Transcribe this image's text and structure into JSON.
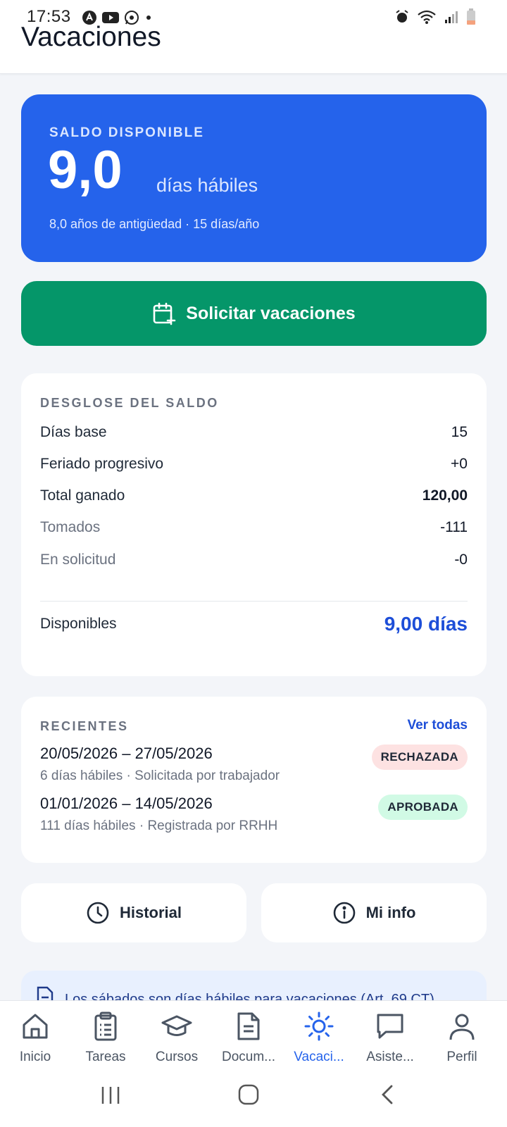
{
  "status_bar": {
    "time": "17:53"
  },
  "header": {
    "title": "Vacaciones"
  },
  "saldo": {
    "label": "SALDO DISPONIBLE",
    "value": "9,0",
    "unit": "días hábiles",
    "subtitle": "8,0 años de antigüedad · 15 días/año"
  },
  "solicitar_button": {
    "label": "Solicitar vacaciones"
  },
  "desglose": {
    "title": "DESGLOSE DEL SALDO",
    "rows": [
      {
        "label": "Días base",
        "value": "15"
      },
      {
        "label": "Feriado progresivo",
        "value": "+0"
      },
      {
        "label": "Total ganado",
        "value": "120,00"
      },
      {
        "label": "Tomados",
        "value": "-111"
      },
      {
        "label": "En solicitud",
        "value": "-0"
      }
    ],
    "disponibles_label": "Disponibles",
    "disponibles_value": "9,00 días"
  },
  "recientes": {
    "title": "RECIENTES",
    "ver_todas": "Ver todas",
    "items": [
      {
        "dates": "20/05/2026 – 27/05/2026",
        "detail": "6 días hábiles · Solicitada por trabajador",
        "status": "RECHAZADA"
      },
      {
        "dates": "01/01/2026 – 14/05/2026",
        "detail": "111 días hábiles · Registrada por RRHH",
        "status": "APROBADA"
      }
    ]
  },
  "actions": {
    "historial": "Historial",
    "mi_info": "Mi info"
  },
  "info_note": {
    "text": "Los sábados son días hábiles para vacaciones (Art. 69 CT)"
  },
  "bottom_nav": {
    "items": [
      {
        "label": "Inicio",
        "icon": "home-icon"
      },
      {
        "label": "Tareas",
        "icon": "clipboard-icon"
      },
      {
        "label": "Cursos",
        "icon": "graduation-cap-icon"
      },
      {
        "label": "Docum...",
        "icon": "document-icon"
      },
      {
        "label": "Vacaci...",
        "icon": "sun-icon",
        "active": true
      },
      {
        "label": "Asiste...",
        "icon": "chat-icon"
      },
      {
        "label": "Perfil",
        "icon": "user-icon"
      }
    ]
  },
  "colors": {
    "primary": "#2563eb",
    "success": "#059669",
    "rejected_bg": "#fde2e2",
    "approved_bg": "#d1fae5"
  }
}
